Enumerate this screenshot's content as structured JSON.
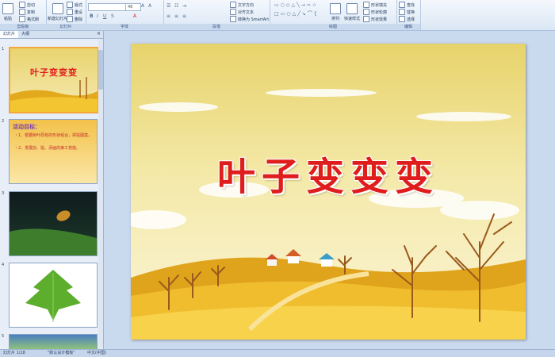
{
  "ribbon": {
    "clipboard": {
      "label": "剪贴板",
      "paste": "粘贴",
      "cut": "剪切",
      "copy": "复制",
      "format_painter": "格式刷"
    },
    "slides": {
      "label": "幻灯片",
      "new_slide": "新建幻灯片",
      "layout": "版式",
      "reset": "重设",
      "delete": "删除"
    },
    "font": {
      "label": "字体",
      "font_name": "",
      "font_size": "48"
    },
    "paragraph": {
      "label": "段落",
      "text_direction": "文字方向",
      "align_text": "对齐文本",
      "smartart": "转换为 SmartArt"
    },
    "drawing": {
      "label": "绘图",
      "arrange": "排列",
      "quick_styles": "快速样式",
      "shape_fill": "形状填充",
      "shape_outline": "形状轮廓",
      "shape_effects": "形状效果"
    },
    "editing": {
      "label": "编辑",
      "find": "查找",
      "replace": "替换",
      "select": "选择"
    }
  },
  "panel": {
    "tab_slides": "幻灯片",
    "tab_outline": "大纲",
    "close": "×",
    "slides": [
      {
        "num": "1",
        "title": "叶子变变变"
      },
      {
        "num": "2",
        "heading": "活动目标：",
        "lines": [
          "・1、根据树叶原有的形状组合，拼贴图案。",
          "・2、发展剪、贴、添画的美工技能。"
        ]
      },
      {
        "num": "3"
      },
      {
        "num": "4"
      },
      {
        "num": "5"
      }
    ]
  },
  "slide": {
    "title": "叶子变变变"
  },
  "status": {
    "slide_info": "幻灯片 1/18",
    "theme": "\"默认设计模板\"",
    "language": "中文(中国)"
  },
  "colors": {
    "title_red": "#e01d1d",
    "selection_orange": "#f3a73a",
    "ribbon_blue": "#dbe7f5"
  }
}
